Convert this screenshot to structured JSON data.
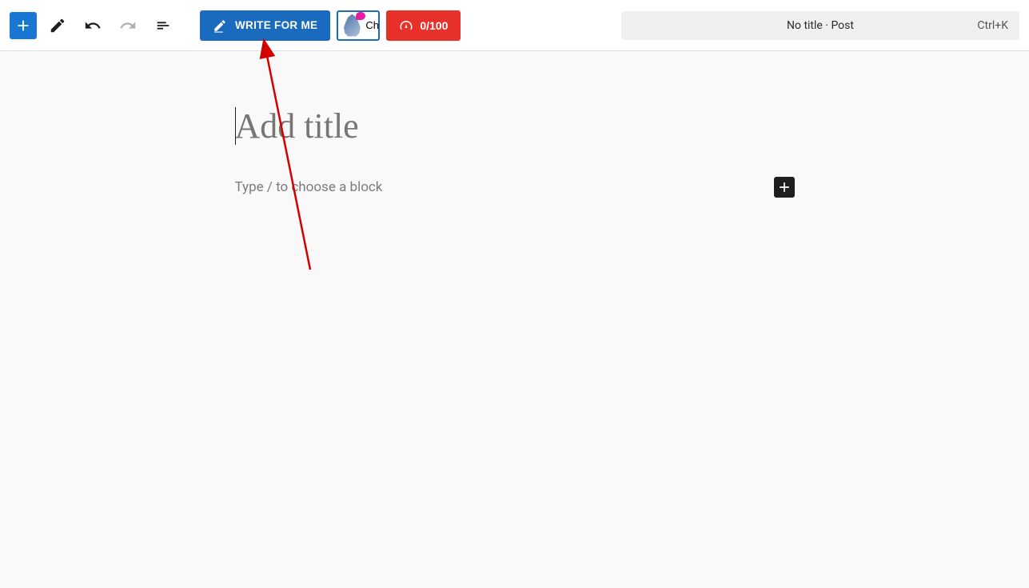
{
  "toolbar": {
    "write_for_me_label": "WRITE FOR ME",
    "chat_label": "Ch",
    "score_label": "0/100"
  },
  "titlebar": {
    "text": "No title · Post",
    "shortcut": "Ctrl+K"
  },
  "editor": {
    "title_placeholder": "Add title",
    "block_placeholder": "Type / to choose a block"
  }
}
